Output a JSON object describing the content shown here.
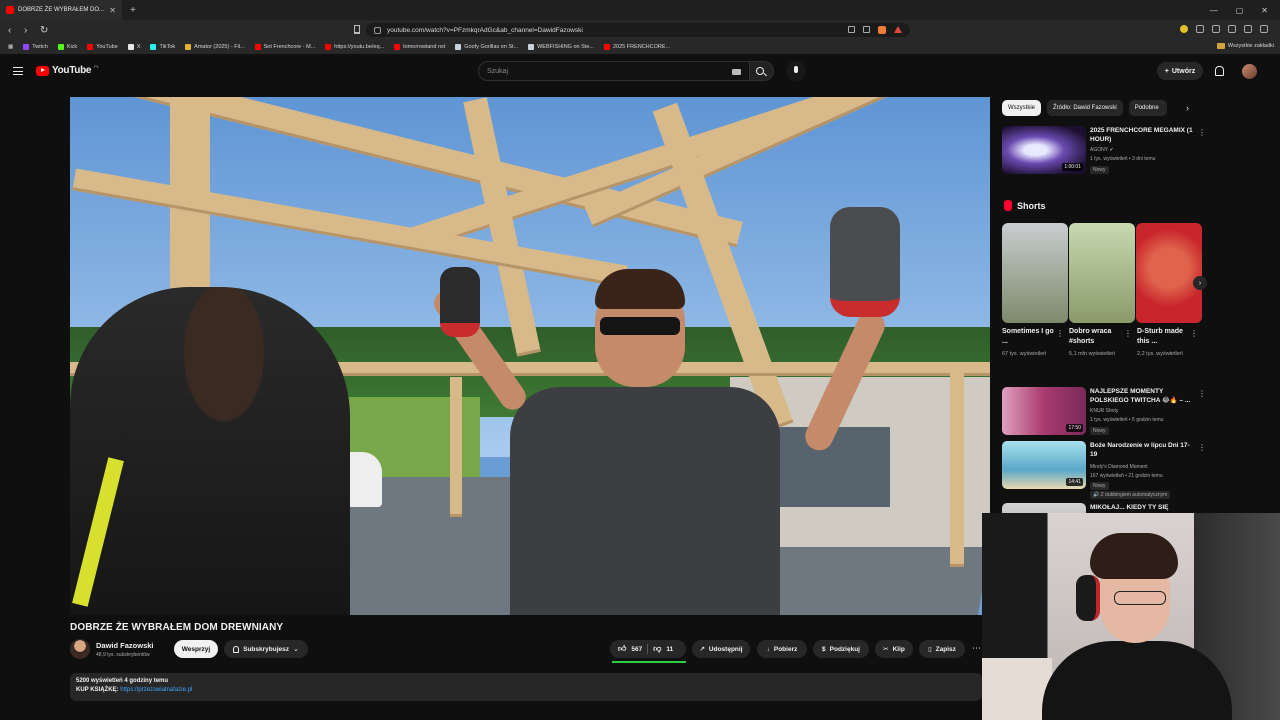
{
  "browser": {
    "tab_title": "DOBRZE ŻE WYBRAŁEM DO...",
    "url": "youtube.com/watch?v=PFzmkqrAdGc&ab_channel=DawidFazowski",
    "new_tab": "+",
    "window_controls": [
      "—",
      "▢",
      "✕"
    ],
    "bookmarks": [
      {
        "label": "Twitch",
        "color": "#9146ff"
      },
      {
        "label": "Kick",
        "color": "#53fc18"
      },
      {
        "label": "YouTube",
        "color": "#ff0000"
      },
      {
        "label": "X",
        "color": "#e8e8e8"
      },
      {
        "label": "TikTok",
        "color": "#25f4ee"
      },
      {
        "label": "Amator (2025) - Fil...",
        "color": "#e0b030"
      },
      {
        "label": "Set Frenchcore - M...",
        "color": "#ff0000"
      },
      {
        "label": "https://youtu.be/eq...",
        "color": "#ff0000"
      },
      {
        "label": "tomorrowland nxt",
        "color": "#ff0000"
      },
      {
        "label": "Goofy Gorillas on St...",
        "color": "#c8d2dc"
      },
      {
        "label": "WEBFISHING on Ste...",
        "color": "#c8d2dc"
      },
      {
        "label": "2025 FRENCHCORE...",
        "color": "#ff0000"
      }
    ],
    "all_bookmarks": "Wszystkie zakładki"
  },
  "youtube": {
    "logo_text": "YouTube",
    "logo_country": "PL",
    "search_placeholder": "Szukaj",
    "create_label": "Utwórz"
  },
  "video": {
    "title": "DOBRZE ŻE WYBRAŁEM DOM DREWNIANY",
    "channel": "Dawid Fazowski",
    "subscribers": "48,9 tys. subskrybentów",
    "support_label": "Wesprzyj",
    "subscribed_label": "Subskrybujesz",
    "likes": "567",
    "dislikes": "11",
    "share_label": "Udostępnij",
    "download_label": "Pobierz",
    "thanks_label": "Podziękuj",
    "clip_label": "Klip",
    "save_label": "Zapisz",
    "description": {
      "stats": "5200 wyświetleń  4 godziny temu",
      "book_prefix": "KUP KSIĄŻKĘ:",
      "book_link": "https://przezswiatnafazie.pl"
    }
  },
  "sidebar": {
    "chips": [
      "Wszystkie",
      "Źródło: Dawid Fazowski",
      "Podobne"
    ],
    "recommendations": [
      {
        "title": "2025 FRENCHCORE MEGAMIX (1 HOUR)",
        "channel": "AGONY ✔",
        "meta": "1 tys. wyświetleń • 3 dni temu",
        "badge": "Nowy",
        "duration": "1:00:01",
        "color": "#3d2a6b"
      }
    ],
    "shorts_heading": "Shorts",
    "shorts": [
      {
        "title": "Sometimes I go ...",
        "views": "67 tys. wyświetleń",
        "color": "#7d8a6a"
      },
      {
        "title": "Dobro wraca #shorts",
        "views": "5,1 mln wyświetleń",
        "color": "#8a9a6a"
      },
      {
        "title": "D-Sturb made this ...",
        "views": "2,2 tys. wyświetleń",
        "color": "#c8262c"
      }
    ],
    "more_recommendations": [
      {
        "title": "NAJLEPSZE MOMENTY POLSKIEGO TWITCHA 😂🔥 – ...",
        "channel": "KNUR Shoty",
        "meta": "1 tys. wyświetleń • 5 godzin temu",
        "badge": "Nowy",
        "duration": "17:50",
        "color": "#a83a6e"
      },
      {
        "title": "Boże Narodzenie w lipcu Dni 17-19",
        "channel": "Mindy's Diamond Moment",
        "meta": "167 wyświetleń • 21 godzin temu",
        "badge": "Nowy",
        "extra": "🔊 Z dubbingiem automatycznym",
        "duration": "14:41",
        "color": "#5aa8c8"
      },
      {
        "title": "MIKOŁAJ... KIEDY TY SIĘ",
        "channel": "",
        "meta": "",
        "badge": "",
        "duration": "",
        "color": "#d4d4d4"
      }
    ]
  }
}
